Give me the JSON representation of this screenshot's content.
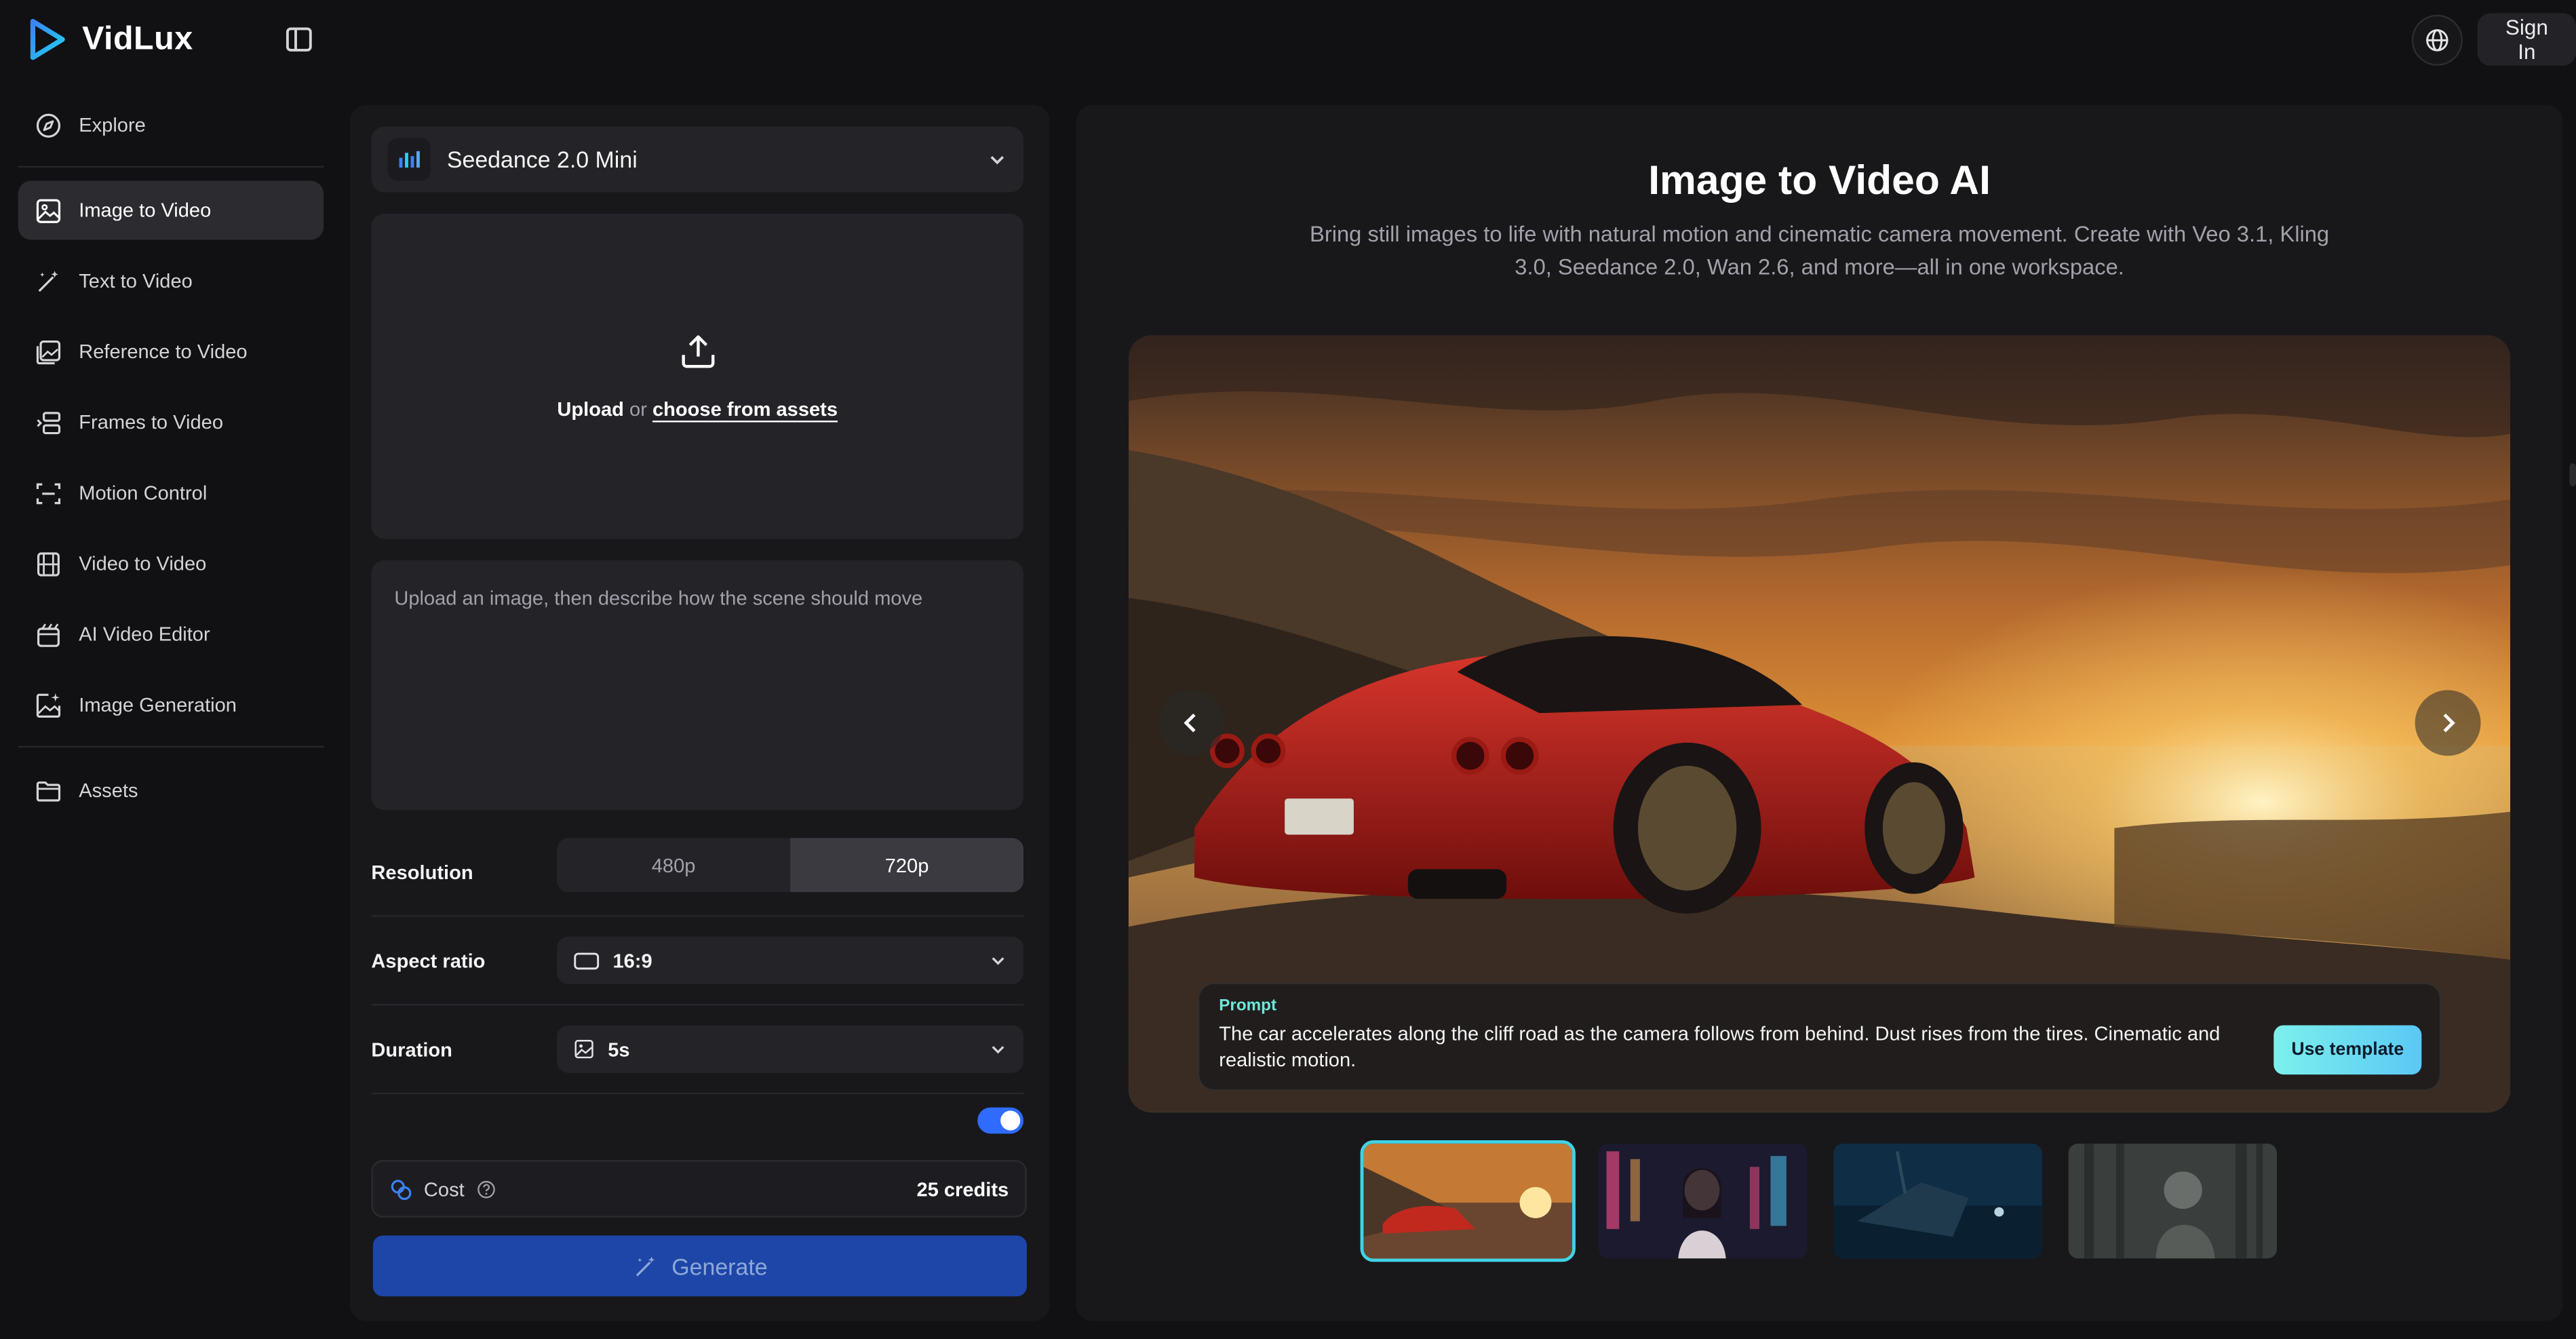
{
  "brand": {
    "name": "VidLux"
  },
  "header": {
    "sign_in_label": "Sign In"
  },
  "sidebar": {
    "items": [
      {
        "label": "Explore",
        "icon": "compass-icon"
      },
      {
        "label": "Image to Video",
        "icon": "image-icon",
        "active": true
      },
      {
        "label": "Text to Video",
        "icon": "magic-wand-icon"
      },
      {
        "label": "Reference to Video",
        "icon": "reference-image-icon"
      },
      {
        "label": "Frames to Video",
        "icon": "frames-icon"
      },
      {
        "label": "Motion Control",
        "icon": "motion-scan-icon"
      },
      {
        "label": "Video to Video",
        "icon": "film-icon"
      },
      {
        "label": "AI Video Editor",
        "icon": "video-editor-icon"
      },
      {
        "label": "Image Generation",
        "icon": "image-sparkle-icon"
      },
      {
        "label": "Assets",
        "icon": "folder-icon"
      }
    ]
  },
  "tool": {
    "model_name": "Seedance 2.0 Mini",
    "upload": {
      "upload_label": "Upload",
      "or_label": "or",
      "assets_link": "choose from assets"
    },
    "prompt_placeholder": "Upload an image, then describe how the scene should move",
    "resolution": {
      "label": "Resolution",
      "options": [
        "480p",
        "720p"
      ],
      "selected": "720p"
    },
    "aspect_ratio": {
      "label": "Aspect ratio",
      "value": "16:9"
    },
    "duration": {
      "label": "Duration",
      "value": "5s"
    },
    "cost": {
      "label": "Cost",
      "value": "25 credits"
    },
    "generate_label": "Generate"
  },
  "showcase": {
    "title": "Image to Video AI",
    "subtitle": "Bring still images to life with natural motion and cinematic camera movement. Create with Veo 3.1, Kling 3.0, Seedance 2.0, Wan 2.6, and more—all in one workspace.",
    "prompt_label": "Prompt",
    "prompt_text": "The car accelerates along the cliff road as the camera follows from behind. Dust rises from the tires. Cinematic and realistic motion.",
    "use_template_label": "Use template",
    "selected_thumbnail": 1,
    "thumbnail_count": 4
  },
  "colors": {
    "accent": "#1d46a8",
    "highlight": "#3fd3e6",
    "toggle": "#2f6bff",
    "template_button": "#7cf0ec"
  }
}
